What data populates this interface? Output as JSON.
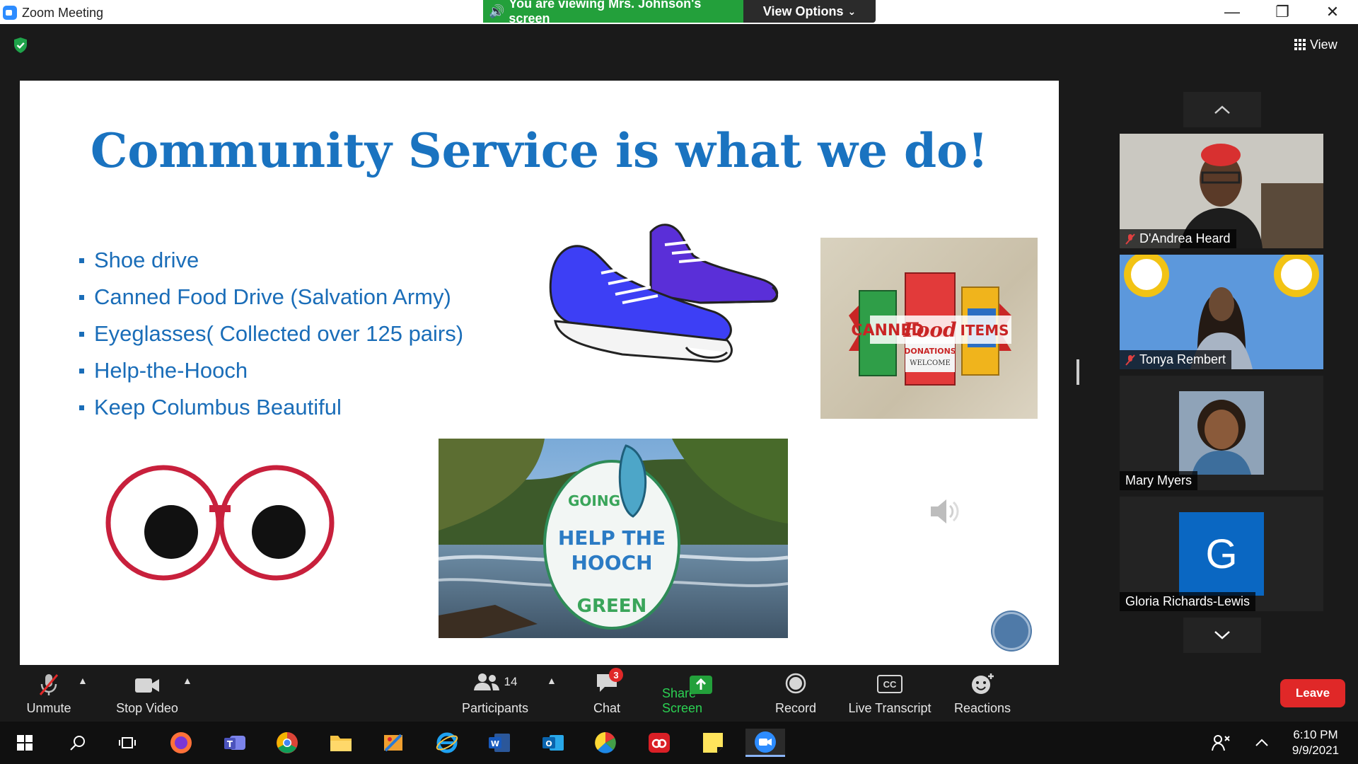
{
  "window": {
    "title": "Zoom Meeting",
    "minimize": "—",
    "restore": "❐",
    "close": "✕"
  },
  "share_banner": {
    "text": "You are viewing Mrs. Johnson's screen",
    "view_options": "View Options"
  },
  "header": {
    "view_label": "View"
  },
  "slide": {
    "title": "Community Service is what we do!",
    "bullets": [
      "Shoe drive",
      "Canned Food Drive (Salvation Army)",
      "Eyeglasses( Collected over 125 pairs)",
      "Help-the-Hooch",
      "Keep Columbus Beautiful"
    ],
    "canned_food": {
      "word1": "CANNED",
      "word2": "Food",
      "word3": "ITEMS",
      "word4": "DONATIONS",
      "word5": "WELCOME"
    },
    "hooch": {
      "top": "GOING",
      "middle1": "HELP THE",
      "middle2": "HOOCH",
      "bottom": "GREEN"
    }
  },
  "gallery": {
    "participants": [
      {
        "name": "D'Andrea Heard",
        "muted": true
      },
      {
        "name": "Tonya Rembert",
        "muted": true
      },
      {
        "name": "Mary Myers",
        "muted": false
      },
      {
        "name": "Gloria Richards-Lewis",
        "muted": false,
        "initial": "G"
      }
    ]
  },
  "toolbar": {
    "unmute": "Unmute",
    "stop_video": "Stop Video",
    "participants": "Participants",
    "participants_count": "14",
    "chat": "Chat",
    "chat_badge": "3",
    "share_screen": "Share Screen",
    "record": "Record",
    "live_transcript": "Live Transcript",
    "reactions": "Reactions",
    "leave": "Leave",
    "cc": "CC"
  },
  "taskbar": {
    "time": "6:10 PM",
    "date": "9/9/2021"
  },
  "colors": {
    "accent_blue": "#1a73c0",
    "banner_green": "#23a03b",
    "leave_red": "#e02828",
    "share_green": "#23a03b"
  }
}
